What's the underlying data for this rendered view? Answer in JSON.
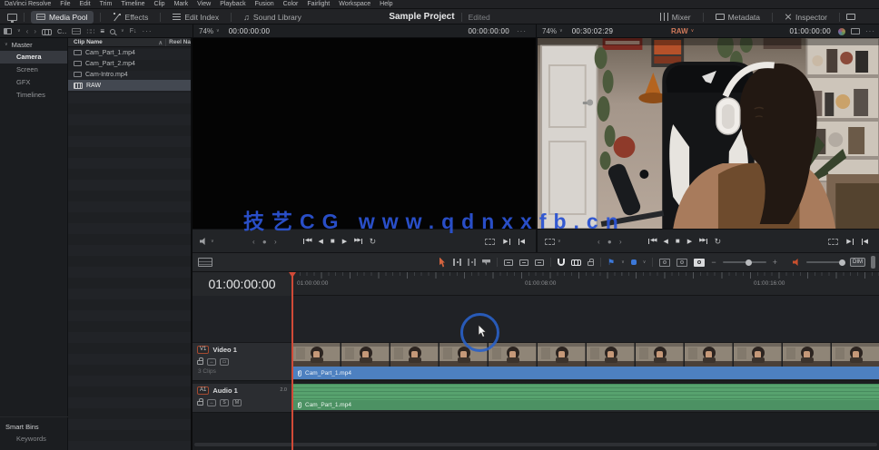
{
  "menu": {
    "items": [
      "DaVinci Resolve",
      "File",
      "Edit",
      "Trim",
      "Timeline",
      "Clip",
      "Mark",
      "View",
      "Playback",
      "Fusion",
      "Color",
      "Fairlight",
      "Workspace",
      "Help"
    ]
  },
  "appbar": {
    "media_pool": "Media Pool",
    "effects": "Effects",
    "edit_index": "Edit Index",
    "sound_library": "Sound Library",
    "project_title": "Sample Project",
    "project_status": "Edited",
    "mixer": "Mixer",
    "metadata": "Metadata",
    "inspector": "Inspector"
  },
  "bins": {
    "root": "Master",
    "items": [
      "Camera",
      "Screen",
      "GFX",
      "Timelines"
    ],
    "selected": "Camera",
    "smart_bins": "Smart Bins",
    "keywords": "Keywords"
  },
  "media_list": {
    "col_clip_name": "Clip Name",
    "col_reel": "Reel Na",
    "clips": [
      {
        "name": "Cam_Part_1.mp4",
        "type": "video"
      },
      {
        "name": "Cam_Part_2.mp4",
        "type": "video"
      },
      {
        "name": "Cam-Intro.mp4",
        "type": "video"
      },
      {
        "name": "RAW",
        "type": "timeline",
        "selected": true
      }
    ]
  },
  "source_viewer": {
    "zoom": "74%",
    "timecode_left": "00:00:00:00",
    "timecode_right": "00:00:00:00"
  },
  "timeline_viewer": {
    "zoom": "74%",
    "duration": "00:30:02:29",
    "timeline_name": "RAW",
    "timecode": "01:00:00:00"
  },
  "edit_toolbar": {
    "dim": "DIM"
  },
  "timeline": {
    "current_timecode": "01:00:00:00",
    "ruler": [
      "01:00:00:00",
      "01:00:08:00",
      "01:00:16:00"
    ],
    "video_track": {
      "badge": "V1",
      "name": "Video 1",
      "info": "3 Clips",
      "clip": "Cam_Part_1.mp4"
    },
    "audio_track": {
      "badge": "A1",
      "name": "Audio 1",
      "channels": "2.0",
      "solo": "S",
      "mute": "M",
      "clip": "Cam_Part_1.mp4"
    }
  },
  "watermark": "技艺CG www.qdnxxfb.cn",
  "colors": {
    "accent_orange": "#d0795a",
    "playhead_red": "#d14a37",
    "clip_blue": "#4d80c0",
    "clip_green": "#57a26e",
    "marker_blue": "#3c78d8",
    "watermark_blue": "#2b53d2",
    "track_badge_border": "#a64a30"
  }
}
